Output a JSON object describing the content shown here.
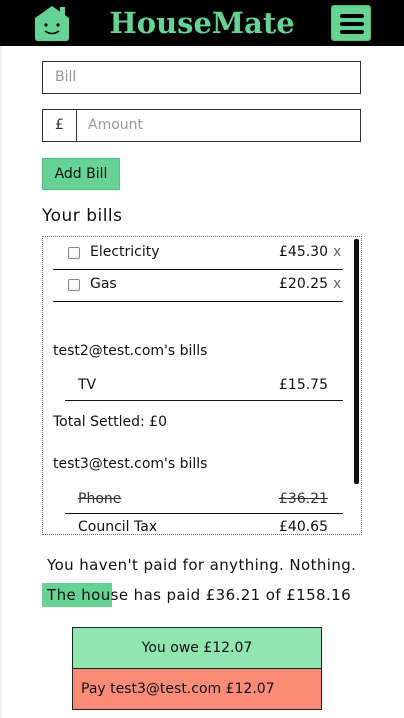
{
  "header": {
    "title": "HouseMate",
    "logo_icon": "house-face-icon",
    "menu_icon": "hamburger-menu-icon",
    "brand_color": "#66d394"
  },
  "form": {
    "bill_placeholder": "Bill",
    "currency_symbol": "£",
    "amount_placeholder": "Amount",
    "add_button": "Add Bill"
  },
  "bills": {
    "heading": "Your bills",
    "my_bills": [
      {
        "name": "Electricity",
        "amount": "£45.30",
        "delete": "x"
      },
      {
        "name": "Gas",
        "amount": "£20.25",
        "delete": "x"
      }
    ],
    "others": [
      {
        "title": "test2@test.com's bills",
        "items": [
          {
            "name": "TV",
            "amount": "£15.75",
            "settled": false
          }
        ],
        "total_settled": "Total Settled: £0"
      },
      {
        "title": "test3@test.com's bills",
        "items": [
          {
            "name": "Phone",
            "amount": "£36.21",
            "settled": true
          },
          {
            "name": "Council Tax",
            "amount": "£40.65",
            "settled": false
          }
        ]
      }
    ]
  },
  "summary": {
    "paid_msg": "You haven't paid for anything. Nothing.",
    "house_msg": "The house has paid £36.21 of £158.16",
    "owe": "You owe £12.07",
    "pay": "Pay test3@test.com £12.07",
    "owe_color": "#90e6ae",
    "pay_color": "#fb8c78"
  }
}
